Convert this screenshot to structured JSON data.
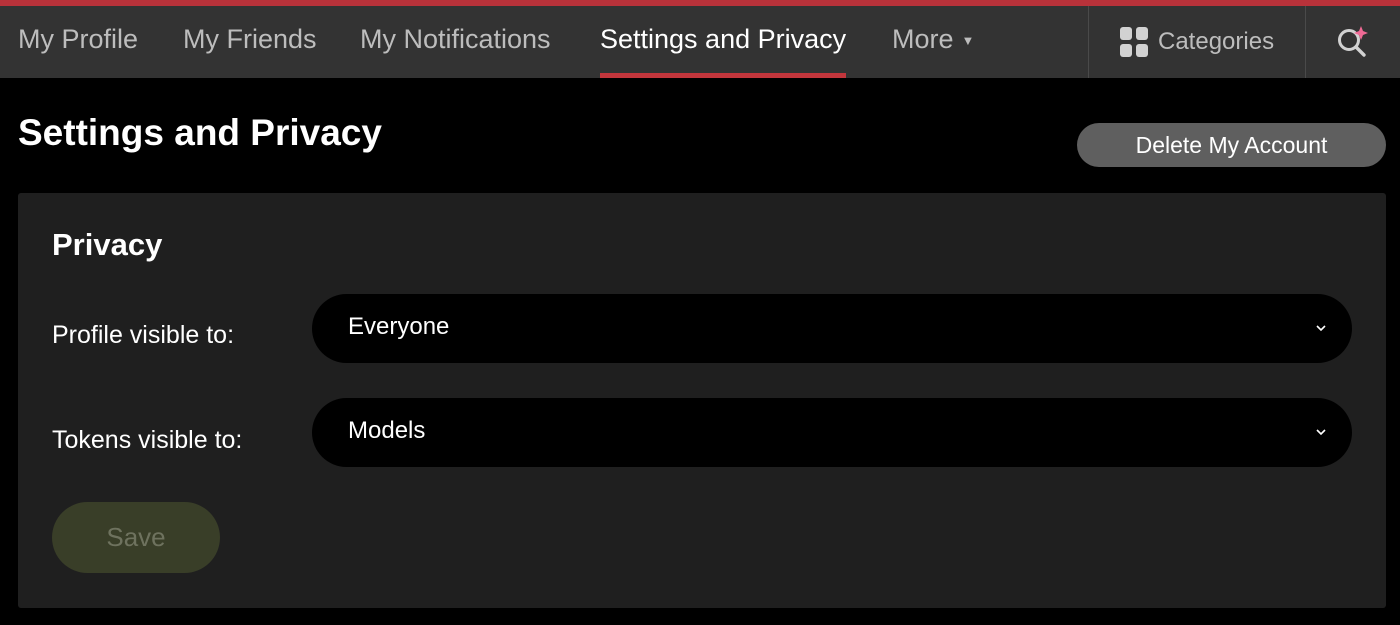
{
  "accent_color": "#c2363c",
  "nav": {
    "items": [
      {
        "label": "My Profile",
        "active": false
      },
      {
        "label": "My Friends",
        "active": false
      },
      {
        "label": "My Notifications",
        "active": false
      },
      {
        "label": "Settings and Privacy",
        "active": true
      },
      {
        "label": "More",
        "active": false
      }
    ],
    "categories_label": "Categories",
    "categories_icon": "grid-icon",
    "search_icon": "sparkle-search-icon"
  },
  "page": {
    "title": "Settings and Privacy",
    "delete_label": "Delete My Account"
  },
  "privacy": {
    "title": "Privacy",
    "fields": [
      {
        "label": "Profile visible to:",
        "value": "Everyone"
      },
      {
        "label": "Tokens visible to:",
        "value": "Models"
      }
    ],
    "save_label": "Save"
  }
}
